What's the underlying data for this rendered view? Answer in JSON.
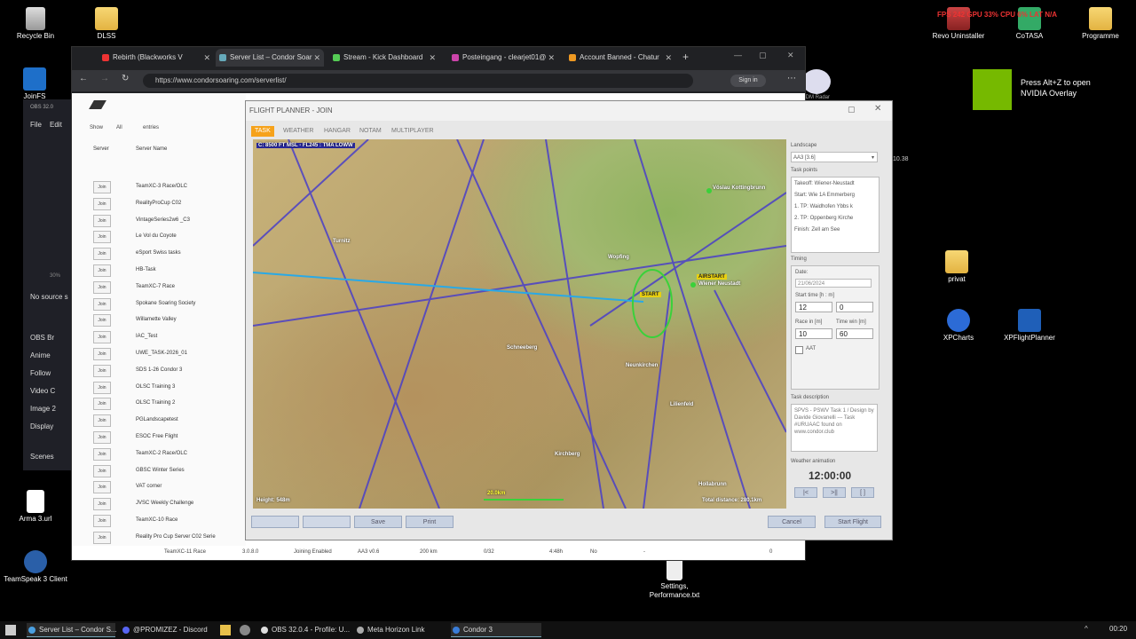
{
  "desktop_icons": {
    "recycle_bin": "Recycle Bin",
    "dlss": "DLSS",
    "joinfs": "JoinFS",
    "revo": "Revo Uninstaller",
    "cotasa": "CoTASA",
    "programme": "Programme",
    "privat": "privat",
    "xpcharts": "XPCharts",
    "xpflightplanner": "XPFlightPlanner",
    "arma": "Arma 3.url",
    "teamspeak": "TeamSpeak 3 Client",
    "settings_file": "Settings, Performance.txt"
  },
  "overlay": {
    "perf": "FPS 242  GPU 33%  CPU 6%  LAT N/A",
    "nvidia_line1": "Press Alt+Z to open",
    "nvidia_line2": "NVIDIA Overlay",
    "tdm_radar": "TDM Radar",
    "time_small": "10.38"
  },
  "browser": {
    "tabs": [
      {
        "label": "Rebirth (Blackworks V",
        "fav": "#e33"
      },
      {
        "label": "Server List – Condor Soar",
        "fav": "#6ab"
      },
      {
        "label": "Stream - Kick Dashboard",
        "fav": "#5c5"
      },
      {
        "label": "Posteingang - clearjet01@",
        "fav": "#c4a"
      },
      {
        "label": "Account Banned - Chatur",
        "fav": "#e92"
      }
    ],
    "url": "https://www.condorsoaring.com/serverlist/",
    "sign_in": "Sign in",
    "list": {
      "show": "Show",
      "all": "All",
      "entries": "entries",
      "col_server": "Server",
      "col_name": "Server Name",
      "join_label": "Join",
      "servers": [
        "TeamXC-3 Race/OLC",
        "RealityProCup C02",
        "VintageSeries2w6 _C3",
        "Le Vol du Coyote",
        "eSport Swiss tasks",
        "HB-Task",
        "TeamXC-7 Race",
        "Spokane Soaring Society",
        "Willamette Valley",
        "IAC_Test",
        "UWE_TASK-2026_01",
        "SDS 1-26 Condor 3",
        "OLSC Training 3",
        "OLSC Training 2",
        "PGLandscapetest",
        "ESOC Free Flight",
        "TeamXC-2 Race/OLC",
        "GBSC Winter Series",
        "VAT corner",
        "JVSC Weekly Challenge",
        "TeamXC-10 Race",
        "Reality Pro Cup Server C02 Serie",
        "TeamXC-11 Race"
      ],
      "last_row": {
        "ver": "3.0.8.0",
        "joining": "Joining Enabled",
        "landscape": "AA3 v0.6",
        "dist": "200 km",
        "players": "0/32",
        "time": "4:48h",
        "pw": "No",
        "dash": "-",
        "count": "0"
      }
    }
  },
  "obs": {
    "title": "OBS 32.0",
    "file": "File",
    "edit": "Edit",
    "no_source": "No source s",
    "items": [
      "OBS Br",
      "Anime",
      "Follow",
      "Video C",
      "Image 2",
      "Display"
    ],
    "scenes": "Scenes",
    "pct": "30%"
  },
  "planner": {
    "title": "FLIGHT PLANNER - JOIN",
    "tabs": [
      "TASK",
      "WEATHER",
      "HANGAR",
      "NOTAM",
      "MULTIPLAYER"
    ],
    "map": {
      "airspace_label": "C: 8500 FT MSL - FL245 : TMA LOWW",
      "height": "Height: 548m",
      "scale": "20.0km",
      "total_distance": "Total distance: 280.1km",
      "airstart": "AIRSTART",
      "start": "START",
      "towns": [
        "Vöslau Kottingbrunn",
        "Wiener Neustadt",
        "Neunkirchen",
        "Kirchberg",
        "Hollabrunn",
        "Wopfing",
        "Turnitz",
        "Schneeberg",
        "Lilienfeld"
      ]
    },
    "side": {
      "landscape_label": "Landscape",
      "landscape_value": "AA3 [3.6]",
      "task_points_label": "Task points",
      "task_points": [
        "Takeoff: Wiener-Neustadt",
        "Start: Wie 1A Emmerberg",
        "1. TP: Waidhofen Ybbs k",
        "2. TP: Oppenberg Kirche",
        "Finish: Zell am See"
      ],
      "timing_label": "Timing",
      "date_label": "Date:",
      "date_value": "21/06/2024",
      "start_time_label": "Start time [h : m]",
      "start_h": "12",
      "start_m": "0",
      "race_label": "Race in [m]",
      "time_win_label": "Time win [m]",
      "race_value": "10",
      "time_win_value": "60",
      "aat_label": "AAT",
      "desc_label": "Task description",
      "desc_text": "SPVS - PSWV Task 1 / Design by Davide Giovanelli --- Task #URUAAC found on www.condor.club",
      "weather_anim_label": "Weather animation",
      "clock": "12:00:00",
      "anim_btns": [
        "|<",
        ">||",
        "[ ]"
      ]
    },
    "buttons": {
      "save": "Save",
      "print": "Print",
      "cancel": "Cancel",
      "start_flight": "Start Flight"
    }
  },
  "taskbar": {
    "items": [
      {
        "label": "Server List – Condor S...",
        "color": "#4a9fe0"
      },
      {
        "label": "@PROMIZEZ - Discord",
        "color": "#5865f2"
      },
      {
        "label": "OBS 32.0.4 - Profile: U...",
        "color": "#ddd"
      },
      {
        "label": "Meta Horizon Link",
        "color": "#aaa"
      },
      {
        "label": "Condor 3",
        "color": "#3a7dd8"
      }
    ],
    "time": "00:20"
  }
}
